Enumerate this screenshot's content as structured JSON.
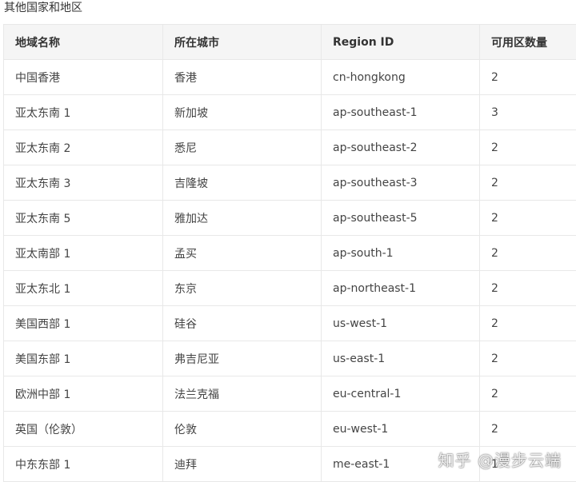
{
  "section": {
    "heading": "其他国家和地区"
  },
  "table": {
    "headers": [
      "地域名称",
      "所在城市",
      "Region ID",
      "可用区数量"
    ],
    "rows": [
      [
        "中国香港",
        "香港",
        "cn-hongkong",
        "2"
      ],
      [
        "亚太东南 1",
        "新加坡",
        "ap-southeast-1",
        "3"
      ],
      [
        "亚太东南 2",
        "悉尼",
        "ap-southeast-2",
        "2"
      ],
      [
        "亚太东南 3",
        "吉隆坡",
        "ap-southeast-3",
        "2"
      ],
      [
        "亚太东南 5",
        "雅加达",
        "ap-southeast-5",
        "2"
      ],
      [
        "亚太南部 1",
        "孟买",
        "ap-south-1",
        "2"
      ],
      [
        "亚太东北 1",
        "东京",
        "ap-northeast-1",
        "2"
      ],
      [
        "美国西部 1",
        "硅谷",
        "us-west-1",
        "2"
      ],
      [
        "美国东部 1",
        "弗吉尼亚",
        "us-east-1",
        "2"
      ],
      [
        "欧洲中部 1",
        "法兰克福",
        "eu-central-1",
        "2"
      ],
      [
        "英国（伦敦）",
        "伦敦",
        "eu-west-1",
        "2"
      ],
      [
        "中东东部 1",
        "迪拜",
        "me-east-1",
        "1"
      ]
    ]
  },
  "watermark": {
    "text": "知乎 @漫步云端"
  }
}
